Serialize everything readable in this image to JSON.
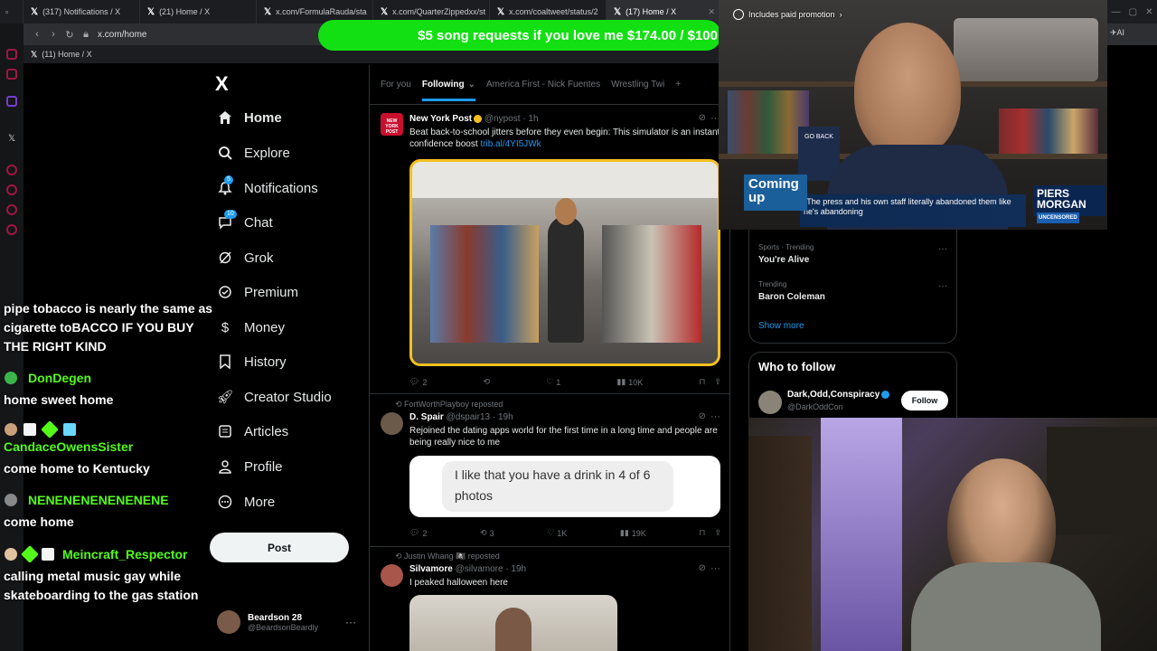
{
  "tabs": [
    {
      "label": "(317) Notifications / X"
    },
    {
      "label": "(21) Home / X"
    },
    {
      "label": "x.com/FormulaRauda/sta"
    },
    {
      "label": "x.com/QuarterZippedxx/st"
    },
    {
      "label": "x.com/coaltweet/status/2"
    },
    {
      "label": "(17) Home / X"
    }
  ],
  "address": "x.com/home",
  "bookmark": "(11) Home / X",
  "promo": "$5 song requests if you love me $174.00 / $100",
  "sidebar": {
    "logo": "X",
    "items": [
      {
        "label": "Home",
        "icon": "home-icon"
      },
      {
        "label": "Explore",
        "icon": "search-icon"
      },
      {
        "label": "Notifications",
        "icon": "bell-icon",
        "badge": "5"
      },
      {
        "label": "Chat",
        "icon": "chat-icon",
        "badge": "10"
      },
      {
        "label": "Grok",
        "icon": "grok-icon"
      },
      {
        "label": "Premium",
        "icon": "premium-icon"
      },
      {
        "label": "Money",
        "icon": "money-icon"
      },
      {
        "label": "History",
        "icon": "bookmark-icon"
      },
      {
        "label": "Creator Studio",
        "icon": "rocket-icon"
      },
      {
        "label": "Articles",
        "icon": "article-icon"
      },
      {
        "label": "Profile",
        "icon": "person-icon"
      },
      {
        "label": "More",
        "icon": "more-icon"
      }
    ],
    "post": "Post",
    "account": {
      "name": "Beardson 28",
      "handle": "@BeardsonBeardly"
    }
  },
  "chat": {
    "lines": [
      {
        "text": "pipe tobacco is nearly the same as"
      },
      {
        "text": "cigarette toBACCO IF YOU BUY"
      },
      {
        "text": "THE RIGHT KIND"
      },
      {
        "user": "DonDegen",
        "text": "home sweet home"
      },
      {
        "user": "CandaceOwensSister",
        "text": "come home to Kentucky"
      },
      {
        "user": "NENENENENENENENE",
        "text": "come home"
      },
      {
        "user": "Meincraft_Respector",
        "text": "calling metal music gay while"
      },
      {
        "text": "skateboarding to the gas station"
      }
    ]
  },
  "feed": {
    "tabs": [
      "For you",
      "Following",
      "America First - Nick Fuentes",
      "Wrestling Twi"
    ],
    "plus": "+",
    "tweets": [
      {
        "name": "New York Post",
        "handle": "@nypost",
        "time": "· 1h",
        "avatar_text": "NEW YORK POST",
        "text": "Beat back-to-school jitters before they even begin: This simulator is an instant confidence boost ",
        "link": "trib.al/4YI5JWk",
        "replies": "2",
        "reposts": "",
        "likes": "1",
        "views": "10K"
      },
      {
        "reposted_by": "FortWorthPlayboy reposted",
        "name": "D. Spair",
        "handle": "@dspair13",
        "time": "· 19h",
        "text": "Rejoined the dating apps world for the first time in a long time and people are being really nice to me",
        "quote": "I like that you have a drink in 4 of 6 photos",
        "replies": "2",
        "reposts": "3",
        "likes": "1K",
        "views": "19K"
      },
      {
        "reposted_by": "Justin Whang 🏴‍☠️ reposted",
        "name": "Silvamore",
        "handle": "@silvamore",
        "time": "· 19h",
        "text": "I peaked halloween here"
      }
    ]
  },
  "trends": [
    {
      "category": "Sports · Trending",
      "name": "You're Alive"
    },
    {
      "category": "Trending",
      "name": "Baron Coleman"
    }
  ],
  "show_more": "Show more",
  "who_to_follow": {
    "title": "Who to follow",
    "name": "Dark,Odd,Conspiracy",
    "handle": "@DarkOddCon",
    "follow": "Follow"
  },
  "video": {
    "paid_promo": "Includes paid promotion",
    "coming_up": "Coming up",
    "caption": "\"The press and his own staff literally abandoned them like he's abandoning",
    "brand": "PIERS MORGAN",
    "brand_sub": "UNCENSORED"
  },
  "colors": {
    "accent": "#1d9bf0",
    "promo": "#12e012",
    "chat_user": "#53fc18"
  }
}
